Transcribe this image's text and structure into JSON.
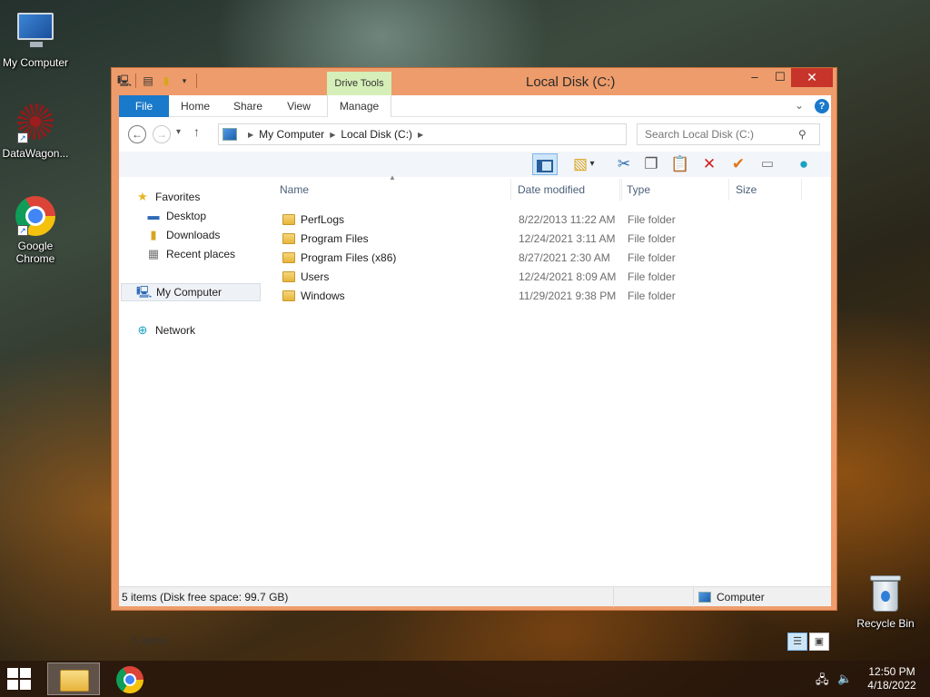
{
  "desktop": {
    "icons": [
      {
        "label": "My Computer"
      },
      {
        "label": "DataWagon..."
      },
      {
        "label": "Google Chrome"
      },
      {
        "label": "Recycle Bin"
      }
    ]
  },
  "window": {
    "title": "Local Disk (C:)",
    "contextual_tab_group": "Drive Tools",
    "controls": {
      "minimize": "–",
      "maximize": "☐",
      "close": "✕"
    },
    "tabs": [
      {
        "label": "File"
      },
      {
        "label": "Home"
      },
      {
        "label": "Share"
      },
      {
        "label": "View"
      },
      {
        "label": "Manage"
      }
    ],
    "address": {
      "crumbs": [
        "My Computer",
        "Local Disk (C:)"
      ]
    },
    "search": {
      "placeholder": "Search Local Disk (C:)"
    },
    "nav": {
      "favorites": "Favorites",
      "items": [
        "Desktop",
        "Downloads",
        "Recent places"
      ],
      "my_computer": "My Computer",
      "network": "Network"
    },
    "columns": [
      "Name",
      "Date modified",
      "Type",
      "Size"
    ],
    "files": [
      {
        "name": "PerfLogs",
        "date": "8/22/2013 11:22 AM",
        "type": "File folder"
      },
      {
        "name": "Program Files",
        "date": "12/24/2021 3:11 AM",
        "type": "File folder"
      },
      {
        "name": "Program Files (x86)",
        "date": "8/27/2021 2:30 AM",
        "type": "File folder"
      },
      {
        "name": "Users",
        "date": "12/24/2021 8:09 AM",
        "type": "File folder"
      },
      {
        "name": "Windows",
        "date": "11/29/2021 9:38 PM",
        "type": "File folder"
      }
    ],
    "item_count": "5 items",
    "status": {
      "left": "5 items (Disk free space: 99.7 GB)",
      "right": "Computer"
    }
  },
  "taskbar": {
    "time": "12:50 PM",
    "date": "4/18/2022"
  },
  "colors": {
    "window_frame": "#ee9c6c",
    "file_tab": "#1979ca",
    "drive_tools": "#d6efb8",
    "close_button": "#c7342a"
  }
}
